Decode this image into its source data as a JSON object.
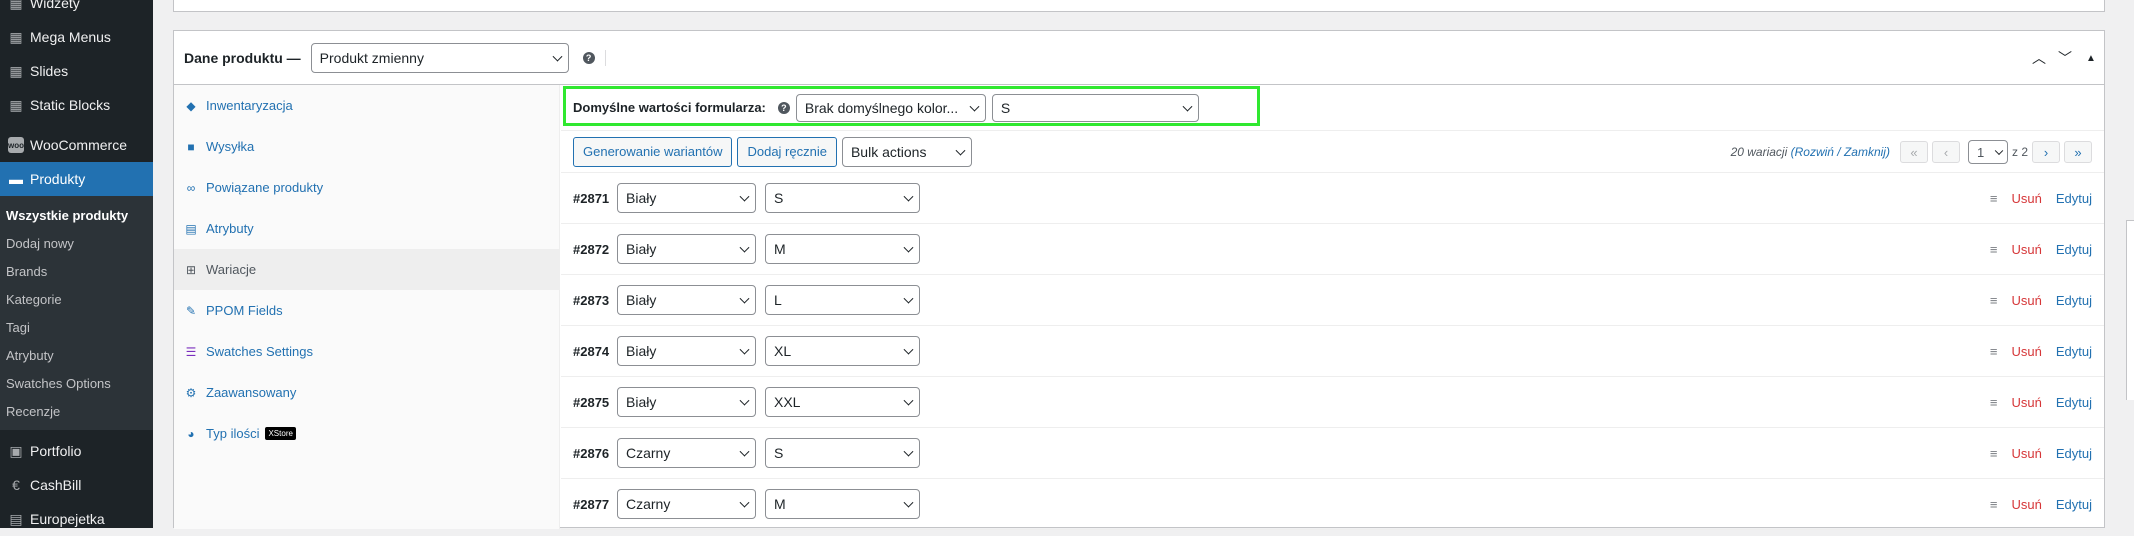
{
  "sidebar": {
    "items_top": [
      {
        "label": "Widżety",
        "icon": "brush-icon"
      },
      {
        "label": "Mega Menus",
        "icon": "grid-icon"
      },
      {
        "label": "Slides",
        "icon": "slides-icon"
      },
      {
        "label": "Static Blocks",
        "icon": "blocks-icon"
      },
      {
        "label": "WooCommerce",
        "icon": "woo-icon"
      },
      {
        "label": "Produkty",
        "icon": "archive-icon"
      }
    ],
    "submenu": [
      "Wszystkie produkty",
      "Dodaj nowy",
      "Brands",
      "Kategorie",
      "Tagi",
      "Atrybuty",
      "Swatches Options",
      "Recenzje"
    ],
    "items_bottom": [
      {
        "label": "Portfolio",
        "icon": "portfolio-icon"
      },
      {
        "label": "CashBill",
        "icon": "cashbill-icon"
      },
      {
        "label": "Europejetka",
        "icon": "europe-icon"
      }
    ]
  },
  "metabox": {
    "title": "Dane produktu —",
    "product_type": "Produkt zmienny",
    "help": "?"
  },
  "tabs": [
    {
      "label": "Inwentaryzacja",
      "icon": "tag-icon",
      "glyph": "◆"
    },
    {
      "label": "Wysyłka",
      "icon": "truck-icon",
      "glyph": "■"
    },
    {
      "label": "Powiązane produkty",
      "icon": "link-icon",
      "glyph": "∞"
    },
    {
      "label": "Atrybuty",
      "icon": "list-icon",
      "glyph": "▤"
    },
    {
      "label": "Wariacje",
      "icon": "variations-icon",
      "glyph": "⊞"
    },
    {
      "label": "PPOM Fields",
      "icon": "wrench-icon",
      "glyph": "✎"
    },
    {
      "label": "Swatches Settings",
      "icon": "swatches-icon",
      "glyph": "☰"
    },
    {
      "label": "Zaawansowany",
      "icon": "gear-icon",
      "glyph": "⚙"
    },
    {
      "label": "Typ ilości",
      "icon": "circle-icon",
      "glyph": "◕",
      "badge": "XStore"
    }
  ],
  "defaults": {
    "label": "Domyślne wartości formularza:",
    "color_select": "Brak domyślnego kolor...",
    "size_select": "S"
  },
  "toolbar": {
    "generate": "Generowanie wariantów",
    "add_manual": "Dodaj ręcznie",
    "bulk": "Bulk actions",
    "count": "20 wariacji",
    "expand": "(Rozwiń / Zamknij)",
    "page": "1",
    "of": "z 2"
  },
  "variations": [
    {
      "id": "#2871",
      "color": "Biały",
      "size": "S"
    },
    {
      "id": "#2872",
      "color": "Biały",
      "size": "M"
    },
    {
      "id": "#2873",
      "color": "Biały",
      "size": "L"
    },
    {
      "id": "#2874",
      "color": "Biały",
      "size": "XL"
    },
    {
      "id": "#2875",
      "color": "Biały",
      "size": "XXL"
    },
    {
      "id": "#2876",
      "color": "Czarny",
      "size": "S"
    },
    {
      "id": "#2877",
      "color": "Czarny",
      "size": "M"
    }
  ],
  "row_actions": {
    "delete": "Usuń",
    "edit": "Edytuj"
  }
}
